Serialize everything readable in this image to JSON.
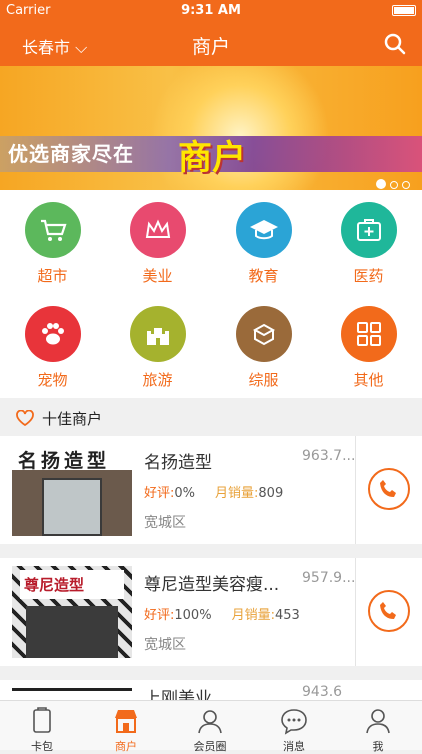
{
  "status_bar": {
    "carrier": "Carrier",
    "time": "9:31 AM"
  },
  "nav": {
    "city": "长春市",
    "title": "商户"
  },
  "banner": {
    "slogan": "优选商家尽在",
    "highlight": "商户"
  },
  "categories": [
    {
      "label": "超市",
      "icon": "shopping-cart-icon",
      "color": "#5cb85c"
    },
    {
      "label": "美业",
      "icon": "crown-icon",
      "color": "#e84a6f"
    },
    {
      "label": "教育",
      "icon": "graduation-cap-icon",
      "color": "#2ba4d6"
    },
    {
      "label": "医药",
      "icon": "medical-kit-icon",
      "color": "#1fb79a"
    },
    {
      "label": "宠物",
      "icon": "paw-icon",
      "color": "#e8343a"
    },
    {
      "label": "旅游",
      "icon": "castle-icon",
      "color": "#a5b22e"
    },
    {
      "label": "综服",
      "icon": "box-icon",
      "color": "#9a6a3a"
    },
    {
      "label": "其他",
      "icon": "grid-icon",
      "color": "#f26a1b"
    }
  ],
  "section": {
    "title": "十佳商户"
  },
  "shops": [
    {
      "name": "名扬造型",
      "distance": "963.7...",
      "rating_label": "好评:",
      "rating": "0%",
      "sales_label": "月销量:",
      "sales": "809",
      "area": "宽城区",
      "sign": "名扬造型"
    },
    {
      "name": "尊尼造型美容瘦...",
      "distance": "957.9...",
      "rating_label": "好评:",
      "rating": "100%",
      "sales_label": "月销量:",
      "sales": "453",
      "area": "宽城区",
      "sign": "尊尼造型"
    },
    {
      "name": "上刚美业",
      "distance": "943.6"
    }
  ],
  "tabbar": [
    {
      "label": "卡包",
      "icon": "wallet-icon"
    },
    {
      "label": "商户",
      "icon": "store-icon",
      "active": true
    },
    {
      "label": "会员圈",
      "icon": "members-icon"
    },
    {
      "label": "消息",
      "icon": "chat-icon"
    },
    {
      "label": "我",
      "icon": "user-icon"
    }
  ]
}
